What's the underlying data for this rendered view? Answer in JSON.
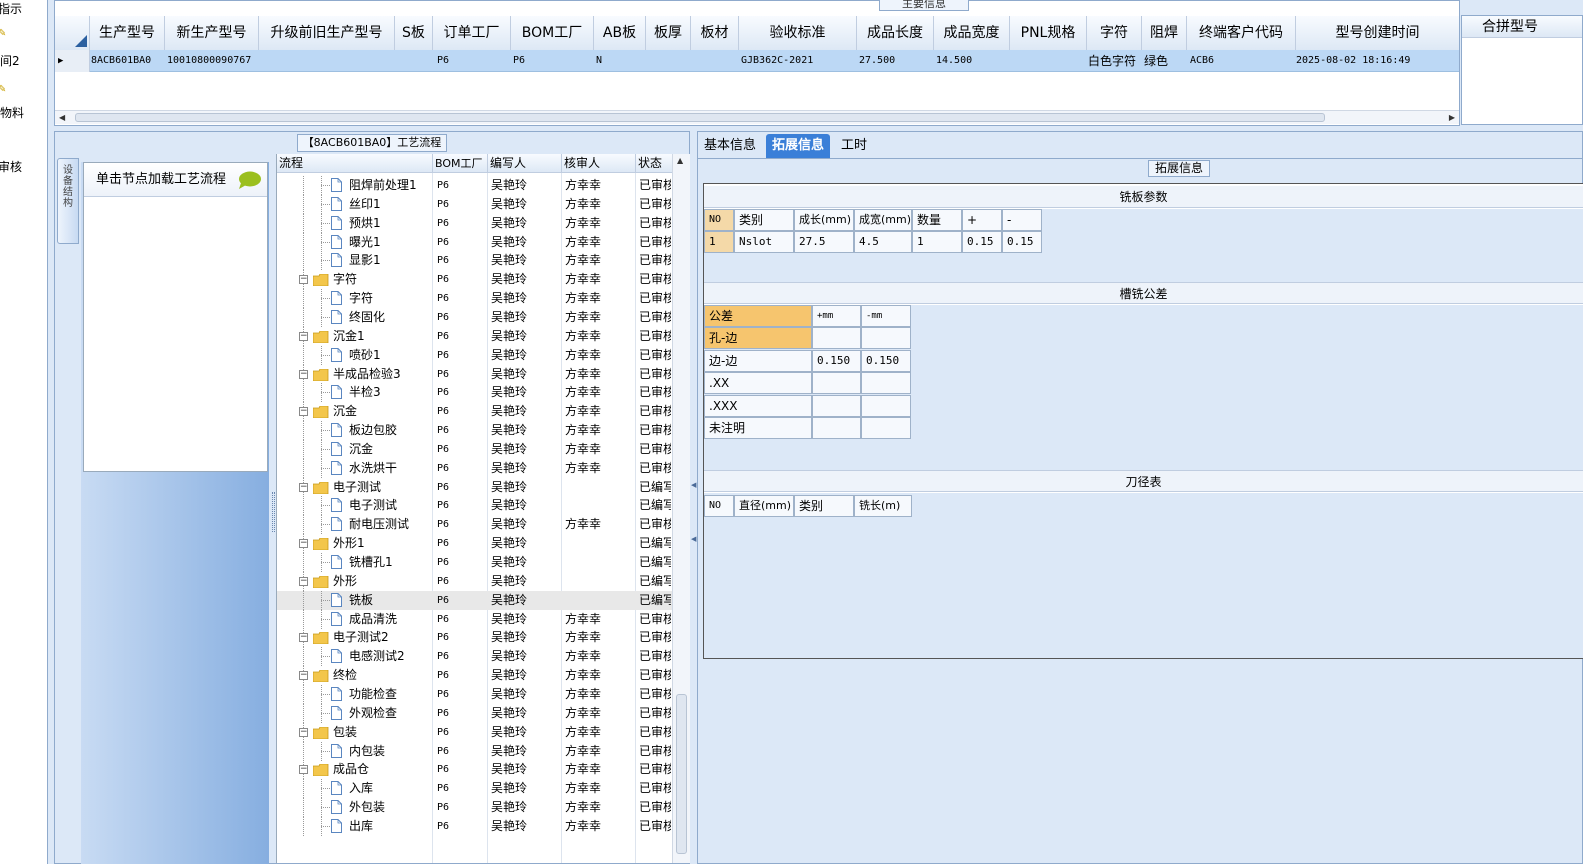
{
  "leftnav": {
    "items": [
      "指示",
      "间2",
      "物料",
      "审核"
    ]
  },
  "main_info": {
    "caption": "主要信息",
    "columns": [
      "生产型号",
      "新生产型号",
      "升级前旧生产型号",
      "S板",
      "订单工厂",
      "BOM工厂",
      "AB板",
      "板厚",
      "板材",
      "验收标准",
      "成品长度",
      "成品宽度",
      "PNL规格",
      "字符",
      "阻焊",
      "终端客户代码",
      "型号创建时间"
    ],
    "row": {
      "marker": "▶",
      "model": "8ACB601BA0",
      "new_model": "10010800090767",
      "order_factory": "P6",
      "bom_factory": "P6",
      "ab_board": "N",
      "standard": "GJB362C-2021",
      "length": "27.500",
      "width": "14.500",
      "char": "白色字符",
      "mask": "绿色",
      "customer": "ACB6",
      "created": "2025-08-02 18:16:49"
    },
    "combine_header": "合拼型号"
  },
  "flow": {
    "caption": "【8ACB601BA0】工艺流程",
    "vtab_label": "设备结构",
    "load_hint": "单击节点加载工艺流程",
    "headers": [
      "流程",
      "BOM工厂",
      "编写人",
      "核审人",
      "状态"
    ],
    "rows": [
      {
        "name": "阻焊前处理1",
        "type": "doc",
        "bom": "P6",
        "writer": "吴艳玲",
        "reviewer": "方幸幸",
        "status": "已审核"
      },
      {
        "name": "丝印1",
        "type": "doc",
        "bom": "P6",
        "writer": "吴艳玲",
        "reviewer": "方幸幸",
        "status": "已审核"
      },
      {
        "name": "预烘1",
        "type": "doc",
        "bom": "P6",
        "writer": "吴艳玲",
        "reviewer": "方幸幸",
        "status": "已审核"
      },
      {
        "name": "曝光1",
        "type": "doc",
        "bom": "P6",
        "writer": "吴艳玲",
        "reviewer": "方幸幸",
        "status": "已审核"
      },
      {
        "name": "显影1",
        "type": "doc",
        "bom": "P6",
        "writer": "吴艳玲",
        "reviewer": "方幸幸",
        "status": "已审核"
      },
      {
        "name": "字符",
        "type": "folder",
        "bom": "P6",
        "writer": "吴艳玲",
        "reviewer": "方幸幸",
        "status": "已审核"
      },
      {
        "name": "字符",
        "type": "doc",
        "bom": "P6",
        "writer": "吴艳玲",
        "reviewer": "方幸幸",
        "status": "已审核"
      },
      {
        "name": "终固化",
        "type": "doc",
        "bom": "P6",
        "writer": "吴艳玲",
        "reviewer": "方幸幸",
        "status": "已审核"
      },
      {
        "name": "沉金1",
        "type": "folder",
        "bom": "P6",
        "writer": "吴艳玲",
        "reviewer": "方幸幸",
        "status": "已审核"
      },
      {
        "name": "喷砂1",
        "type": "doc",
        "bom": "P6",
        "writer": "吴艳玲",
        "reviewer": "方幸幸",
        "status": "已审核"
      },
      {
        "name": "半成品检验3",
        "type": "folder",
        "bom": "P6",
        "writer": "吴艳玲",
        "reviewer": "方幸幸",
        "status": "已审核"
      },
      {
        "name": "半检3",
        "type": "doc",
        "bom": "P6",
        "writer": "吴艳玲",
        "reviewer": "方幸幸",
        "status": "已审核"
      },
      {
        "name": "沉金",
        "type": "folder",
        "bom": "P6",
        "writer": "吴艳玲",
        "reviewer": "方幸幸",
        "status": "已审核"
      },
      {
        "name": "板边包胶",
        "type": "doc",
        "bom": "P6",
        "writer": "吴艳玲",
        "reviewer": "方幸幸",
        "status": "已审核"
      },
      {
        "name": "沉金",
        "type": "doc",
        "bom": "P6",
        "writer": "吴艳玲",
        "reviewer": "方幸幸",
        "status": "已审核"
      },
      {
        "name": "水洗烘干",
        "type": "doc",
        "bom": "P6",
        "writer": "吴艳玲",
        "reviewer": "方幸幸",
        "status": "已审核"
      },
      {
        "name": "电子测试",
        "type": "folder",
        "bom": "P6",
        "writer": "吴艳玲",
        "reviewer": "",
        "status": "已编写"
      },
      {
        "name": "电子测试",
        "type": "doc",
        "bom": "P6",
        "writer": "吴艳玲",
        "reviewer": "",
        "status": "已编写"
      },
      {
        "name": "耐电压测试",
        "type": "doc",
        "bom": "P6",
        "writer": "吴艳玲",
        "reviewer": "方幸幸",
        "status": "已审核"
      },
      {
        "name": "外形1",
        "type": "folder",
        "bom": "P6",
        "writer": "吴艳玲",
        "reviewer": "",
        "status": "已编写"
      },
      {
        "name": "铣槽孔1",
        "type": "doc",
        "bom": "P6",
        "writer": "吴艳玲",
        "reviewer": "",
        "status": "已编写"
      },
      {
        "name": "外形",
        "type": "folder",
        "bom": "P6",
        "writer": "吴艳玲",
        "reviewer": "",
        "status": "已编写"
      },
      {
        "name": "铣板",
        "type": "doc",
        "bom": "P6",
        "writer": "吴艳玲",
        "reviewer": "",
        "status": "已编写",
        "selected": true
      },
      {
        "name": "成品清洗",
        "type": "doc",
        "bom": "P6",
        "writer": "吴艳玲",
        "reviewer": "方幸幸",
        "status": "已审核"
      },
      {
        "name": "电子测试2",
        "type": "folder",
        "bom": "P6",
        "writer": "吴艳玲",
        "reviewer": "方幸幸",
        "status": "已审核"
      },
      {
        "name": "电感测试2",
        "type": "doc",
        "bom": "P6",
        "writer": "吴艳玲",
        "reviewer": "方幸幸",
        "status": "已审核"
      },
      {
        "name": "终检",
        "type": "folder",
        "bom": "P6",
        "writer": "吴艳玲",
        "reviewer": "方幸幸",
        "status": "已审核"
      },
      {
        "name": "功能检查",
        "type": "doc",
        "bom": "P6",
        "writer": "吴艳玲",
        "reviewer": "方幸幸",
        "status": "已审核"
      },
      {
        "name": "外观检查",
        "type": "doc",
        "bom": "P6",
        "writer": "吴艳玲",
        "reviewer": "方幸幸",
        "status": "已审核"
      },
      {
        "name": "包装",
        "type": "folder",
        "bom": "P6",
        "writer": "吴艳玲",
        "reviewer": "方幸幸",
        "status": "已审核"
      },
      {
        "name": "内包装",
        "type": "doc",
        "bom": "P6",
        "writer": "吴艳玲",
        "reviewer": "方幸幸",
        "status": "已审核"
      },
      {
        "name": "成品仓",
        "type": "folder",
        "bom": "P6",
        "writer": "吴艳玲",
        "reviewer": "方幸幸",
        "status": "已审核"
      },
      {
        "name": "入库",
        "type": "doc",
        "bom": "P6",
        "writer": "吴艳玲",
        "reviewer": "方幸幸",
        "status": "已审核"
      },
      {
        "name": "外包装",
        "type": "doc",
        "bom": "P6",
        "writer": "吴艳玲",
        "reviewer": "方幸幸",
        "status": "已审核"
      },
      {
        "name": "出库",
        "type": "doc",
        "bom": "P6",
        "writer": "吴艳玲",
        "reviewer": "方幸幸",
        "status": "已审核"
      }
    ]
  },
  "tabs": {
    "items": [
      "基本信息",
      "拓展信息",
      "工时"
    ],
    "active": 1
  },
  "ext": {
    "caption": "拓展信息",
    "board_section": {
      "title": "铣板参数",
      "headers": [
        "NO",
        "类别",
        "成长(mm)",
        "成宽(mm)",
        "数量",
        "+",
        "-"
      ],
      "row": [
        "1",
        "Nslot",
        "27.5",
        "4.5",
        "1",
        "0.15",
        "0.15"
      ]
    },
    "tolerance_section": {
      "title": "槽铣公差",
      "headers": [
        "公差",
        "+mm",
        "-mm"
      ],
      "rows": [
        {
          "label": "孔-边",
          "plus": "",
          "minus": ""
        },
        {
          "label": "边-边",
          "plus": "0.150",
          "minus": "0.150"
        },
        {
          "label": ".XX",
          "plus": "",
          "minus": ""
        },
        {
          "label": ".XXX",
          "plus": "",
          "minus": ""
        },
        {
          "label": "未注明",
          "plus": "",
          "minus": ""
        }
      ]
    },
    "tool_section": {
      "title": "刀径表",
      "headers": [
        "NO",
        "直径(mm)",
        "类别",
        "铣长(m)"
      ]
    }
  },
  "colors": {
    "accent": "#3a7fd8",
    "selection": "#bcd8f5",
    "highlight": "#f6c56e",
    "panel_bg": "#dce8f7",
    "folder": "#f3c64b",
    "bubble": "#9bbf1e"
  }
}
